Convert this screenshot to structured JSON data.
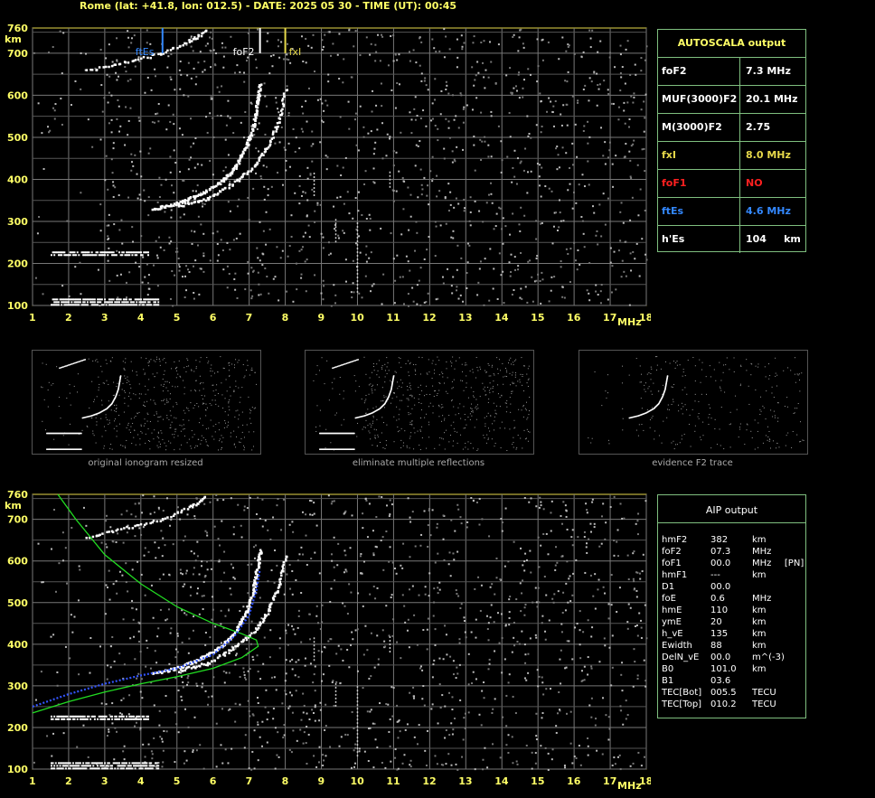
{
  "header": {
    "text": "Rome (lat: +41.8, lon: 012.5) - DATE: 2025 05 30 - TIME (UT): 00:45"
  },
  "autoscala": {
    "title": "AUTOSCALA output",
    "rows": [
      {
        "label": "foF2",
        "value": "7.3 MHz",
        "color": "#ffffff"
      },
      {
        "label": "MUF(3000)F2",
        "value": "20.1 MHz",
        "color": "#ffffff"
      },
      {
        "label": "M(3000)F2",
        "value": "2.75",
        "color": "#ffffff"
      },
      {
        "label": "fxI",
        "value": "8.0 MHz",
        "color": "#e6d84a"
      },
      {
        "label": "foF1",
        "value": "NO",
        "color": "#ff2020"
      },
      {
        "label": "ftEs",
        "value": "4.6 MHz",
        "color": "#3388ff"
      },
      {
        "label": "h'Es",
        "value": "104     km",
        "color": "#ffffff"
      }
    ]
  },
  "aip": {
    "title": "AIP output",
    "rows": [
      [
        "hmF2",
        "382",
        "km",
        ""
      ],
      [
        "foF2",
        "07.3",
        "MHz",
        ""
      ],
      [
        "foF1",
        "00.0",
        "MHz",
        "[PN]"
      ],
      [
        "hmF1",
        "---",
        "km",
        ""
      ],
      [
        "D1",
        "00.0",
        "",
        ""
      ],
      [
        "foE",
        "0.6",
        "MHz",
        ""
      ],
      [
        "hmE",
        "110",
        "km",
        ""
      ],
      [
        "ymE",
        "20",
        "km",
        ""
      ],
      [
        "h_vE",
        "135",
        "km",
        ""
      ],
      [
        "Ewidth",
        "88",
        "km",
        ""
      ],
      [
        "DelN_vE",
        "00.0",
        "m^(-3)",
        ""
      ],
      [
        "B0",
        "101.0",
        "km",
        ""
      ],
      [
        "B1",
        "03.6",
        "",
        ""
      ],
      [
        "TEC[Bot]",
        "005.5",
        "TECU",
        ""
      ],
      [
        "TEC[Top]",
        "010.2",
        "TECU",
        ""
      ]
    ]
  },
  "thumbnails": {
    "captions": [
      "original ionogram resized",
      "eliminate multiple reflections",
      "evidence F2 trace"
    ]
  },
  "chart_data": [
    {
      "type": "scatter",
      "name": "top-ionogram",
      "xlim": [
        1,
        18
      ],
      "ylim": [
        100,
        760
      ],
      "x_ticks": [
        1,
        2,
        3,
        4,
        5,
        6,
        7,
        8,
        9,
        10,
        11,
        12,
        13,
        14,
        15,
        16,
        17,
        18
      ],
      "y_ticks": [
        100,
        200,
        300,
        400,
        500,
        600,
        700,
        760
      ],
      "xunit": "MHz",
      "yunit": "km",
      "grid": true,
      "markers": [
        {
          "label": "ftEs",
          "x": 4.6,
          "color": "#3388ff"
        },
        {
          "label": "foF2",
          "x": 7.3,
          "color": "#ffffff"
        },
        {
          "label": "fxI",
          "x": 8.0,
          "color": "#e6d84a"
        }
      ],
      "traces": {
        "es_layer": {
          "x_start": 1.5,
          "x_end": 4.5,
          "h": 110
        },
        "es_second": {
          "x_start": 1.5,
          "x_end": 4.2,
          "h": 222
        },
        "f2_ordinary": {
          "points": [
            [
              4.3,
              330
            ],
            [
              5,
              345
            ],
            [
              5.6,
              365
            ],
            [
              6.2,
              395
            ],
            [
              6.6,
              430
            ],
            [
              6.9,
              480
            ],
            [
              7.1,
              530
            ],
            [
              7.2,
              580
            ],
            [
              7.3,
              630
            ]
          ]
        },
        "f2_extra": {
          "points": [
            [
              5,
              338
            ],
            [
              5.8,
              355
            ],
            [
              6.5,
              390
            ],
            [
              7.1,
              430
            ],
            [
              7.5,
              480
            ],
            [
              7.8,
              540
            ],
            [
              8.0,
              620
            ]
          ]
        },
        "high_echo": {
          "points": [
            [
              2.5,
              660
            ],
            [
              3.5,
              680
            ],
            [
              4.5,
              700
            ],
            [
              5.3,
              730
            ],
            [
              5.8,
              755
            ]
          ]
        }
      }
    },
    {
      "type": "scatter",
      "name": "bottom-ionogram",
      "xlim": [
        1,
        18
      ],
      "ylim": [
        100,
        760
      ],
      "x_ticks": [
        1,
        2,
        3,
        4,
        5,
        6,
        7,
        8,
        9,
        10,
        11,
        12,
        13,
        14,
        15,
        16,
        17,
        18
      ],
      "y_ticks": [
        100,
        200,
        300,
        400,
        500,
        600,
        700,
        760
      ],
      "xunit": "MHz",
      "yunit": "km",
      "grid": true,
      "profile_green": {
        "points": [
          [
            1,
            235
          ],
          [
            2,
            262
          ],
          [
            3,
            285
          ],
          [
            4,
            305
          ],
          [
            5,
            322
          ],
          [
            6,
            342
          ],
          [
            6.8,
            368
          ],
          [
            7.25,
            395
          ],
          [
            7.2,
            410
          ],
          [
            6.8,
            425
          ],
          [
            6,
            450
          ],
          [
            5,
            490
          ],
          [
            4,
            545
          ],
          [
            3,
            615
          ],
          [
            2.2,
            700
          ],
          [
            1.7,
            760
          ]
        ]
      },
      "profile_blue": {
        "points": [
          [
            1,
            250
          ],
          [
            2,
            280
          ],
          [
            3,
            305
          ],
          [
            4,
            325
          ],
          [
            5,
            342
          ],
          [
            6,
            375
          ],
          [
            6.6,
            420
          ],
          [
            7,
            470
          ],
          [
            7.2,
            530
          ],
          [
            7.3,
            580
          ]
        ]
      }
    }
  ]
}
